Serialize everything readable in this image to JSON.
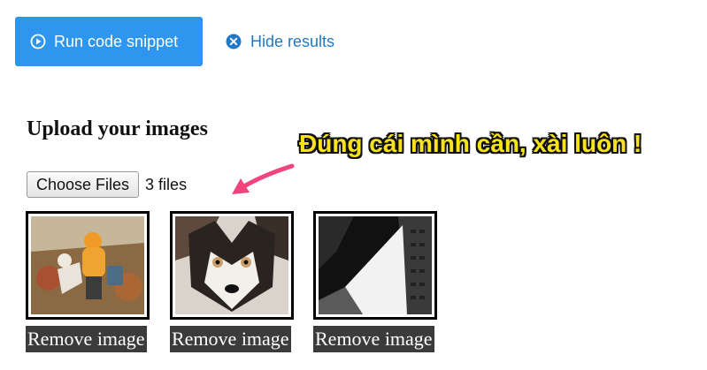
{
  "toolbar": {
    "run_label": "Run code snippet",
    "hide_label": "Hide results",
    "run_bg": "#2e96ee",
    "link_color": "#2178c5"
  },
  "upload": {
    "heading": "Upload your images",
    "choose_label": "Choose Files",
    "file_count": "3 files"
  },
  "thumbnails": [
    {
      "image": "child-with-dog-photo",
      "remove_label": "Remove image"
    },
    {
      "image": "husky-puppy-photo",
      "remove_label": "Remove image"
    },
    {
      "image": "building-bw-photo",
      "remove_label": "Remove image"
    }
  ],
  "annotation": {
    "text": "Đúng cái mình cần, xài luôn !",
    "text_color": "#f7e21b",
    "arrow_color": "#f0447c"
  }
}
